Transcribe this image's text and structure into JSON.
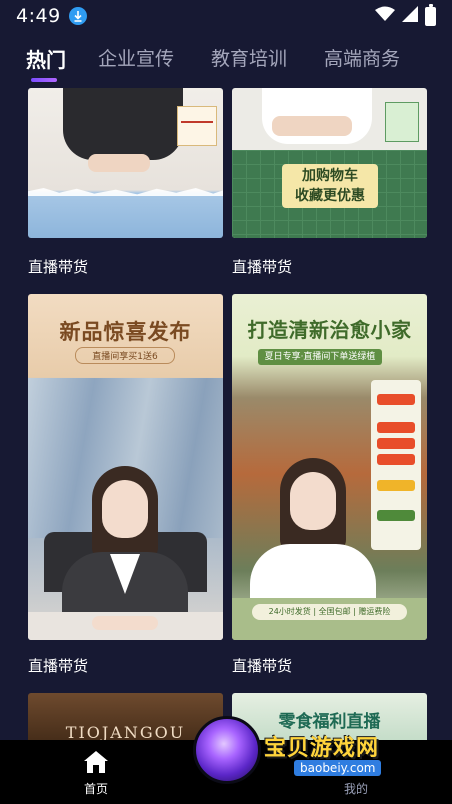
{
  "status_bar": {
    "time": "4:49",
    "icons": [
      "download-icon",
      "wifi-icon",
      "signal-icon",
      "battery-icon"
    ]
  },
  "tabs": [
    {
      "label": "热门",
      "active": true
    },
    {
      "label": "企业宣传",
      "active": false
    },
    {
      "label": "教育培训",
      "active": false
    },
    {
      "label": "高端商务",
      "active": false
    }
  ],
  "cards": [
    {
      "label": "直播带货",
      "overlay_text": ""
    },
    {
      "label": "直播带货",
      "overlay_text": "加购物车\n收藏更优惠"
    },
    {
      "label": "直播带货",
      "overlay_text": "新品惊喜发布",
      "overlay_sub": "直播间享买1送6"
    },
    {
      "label": "直播带货",
      "overlay_text": "打造清新治愈小家",
      "overlay_sub": "夏日专享·直播间下单送绿植",
      "overlay_bottom": "24小时发货 | 全国包邮 | 赠运费险"
    },
    {
      "label": "",
      "overlay_text": "TIOJANGOU"
    },
    {
      "label": "",
      "overlay_text": "零食福利直播"
    }
  ],
  "bottom_nav": {
    "home_label": "首页",
    "mine_label": "我的"
  },
  "watermark": {
    "main": "宝贝游戏网",
    "url": "baobeiy.com"
  },
  "colors": {
    "background": "#171933",
    "tab_active": "#ffffff",
    "tab_inactive": "#a4a6bb",
    "indicator": "#8a55ff",
    "nav_bg": "#000000"
  }
}
